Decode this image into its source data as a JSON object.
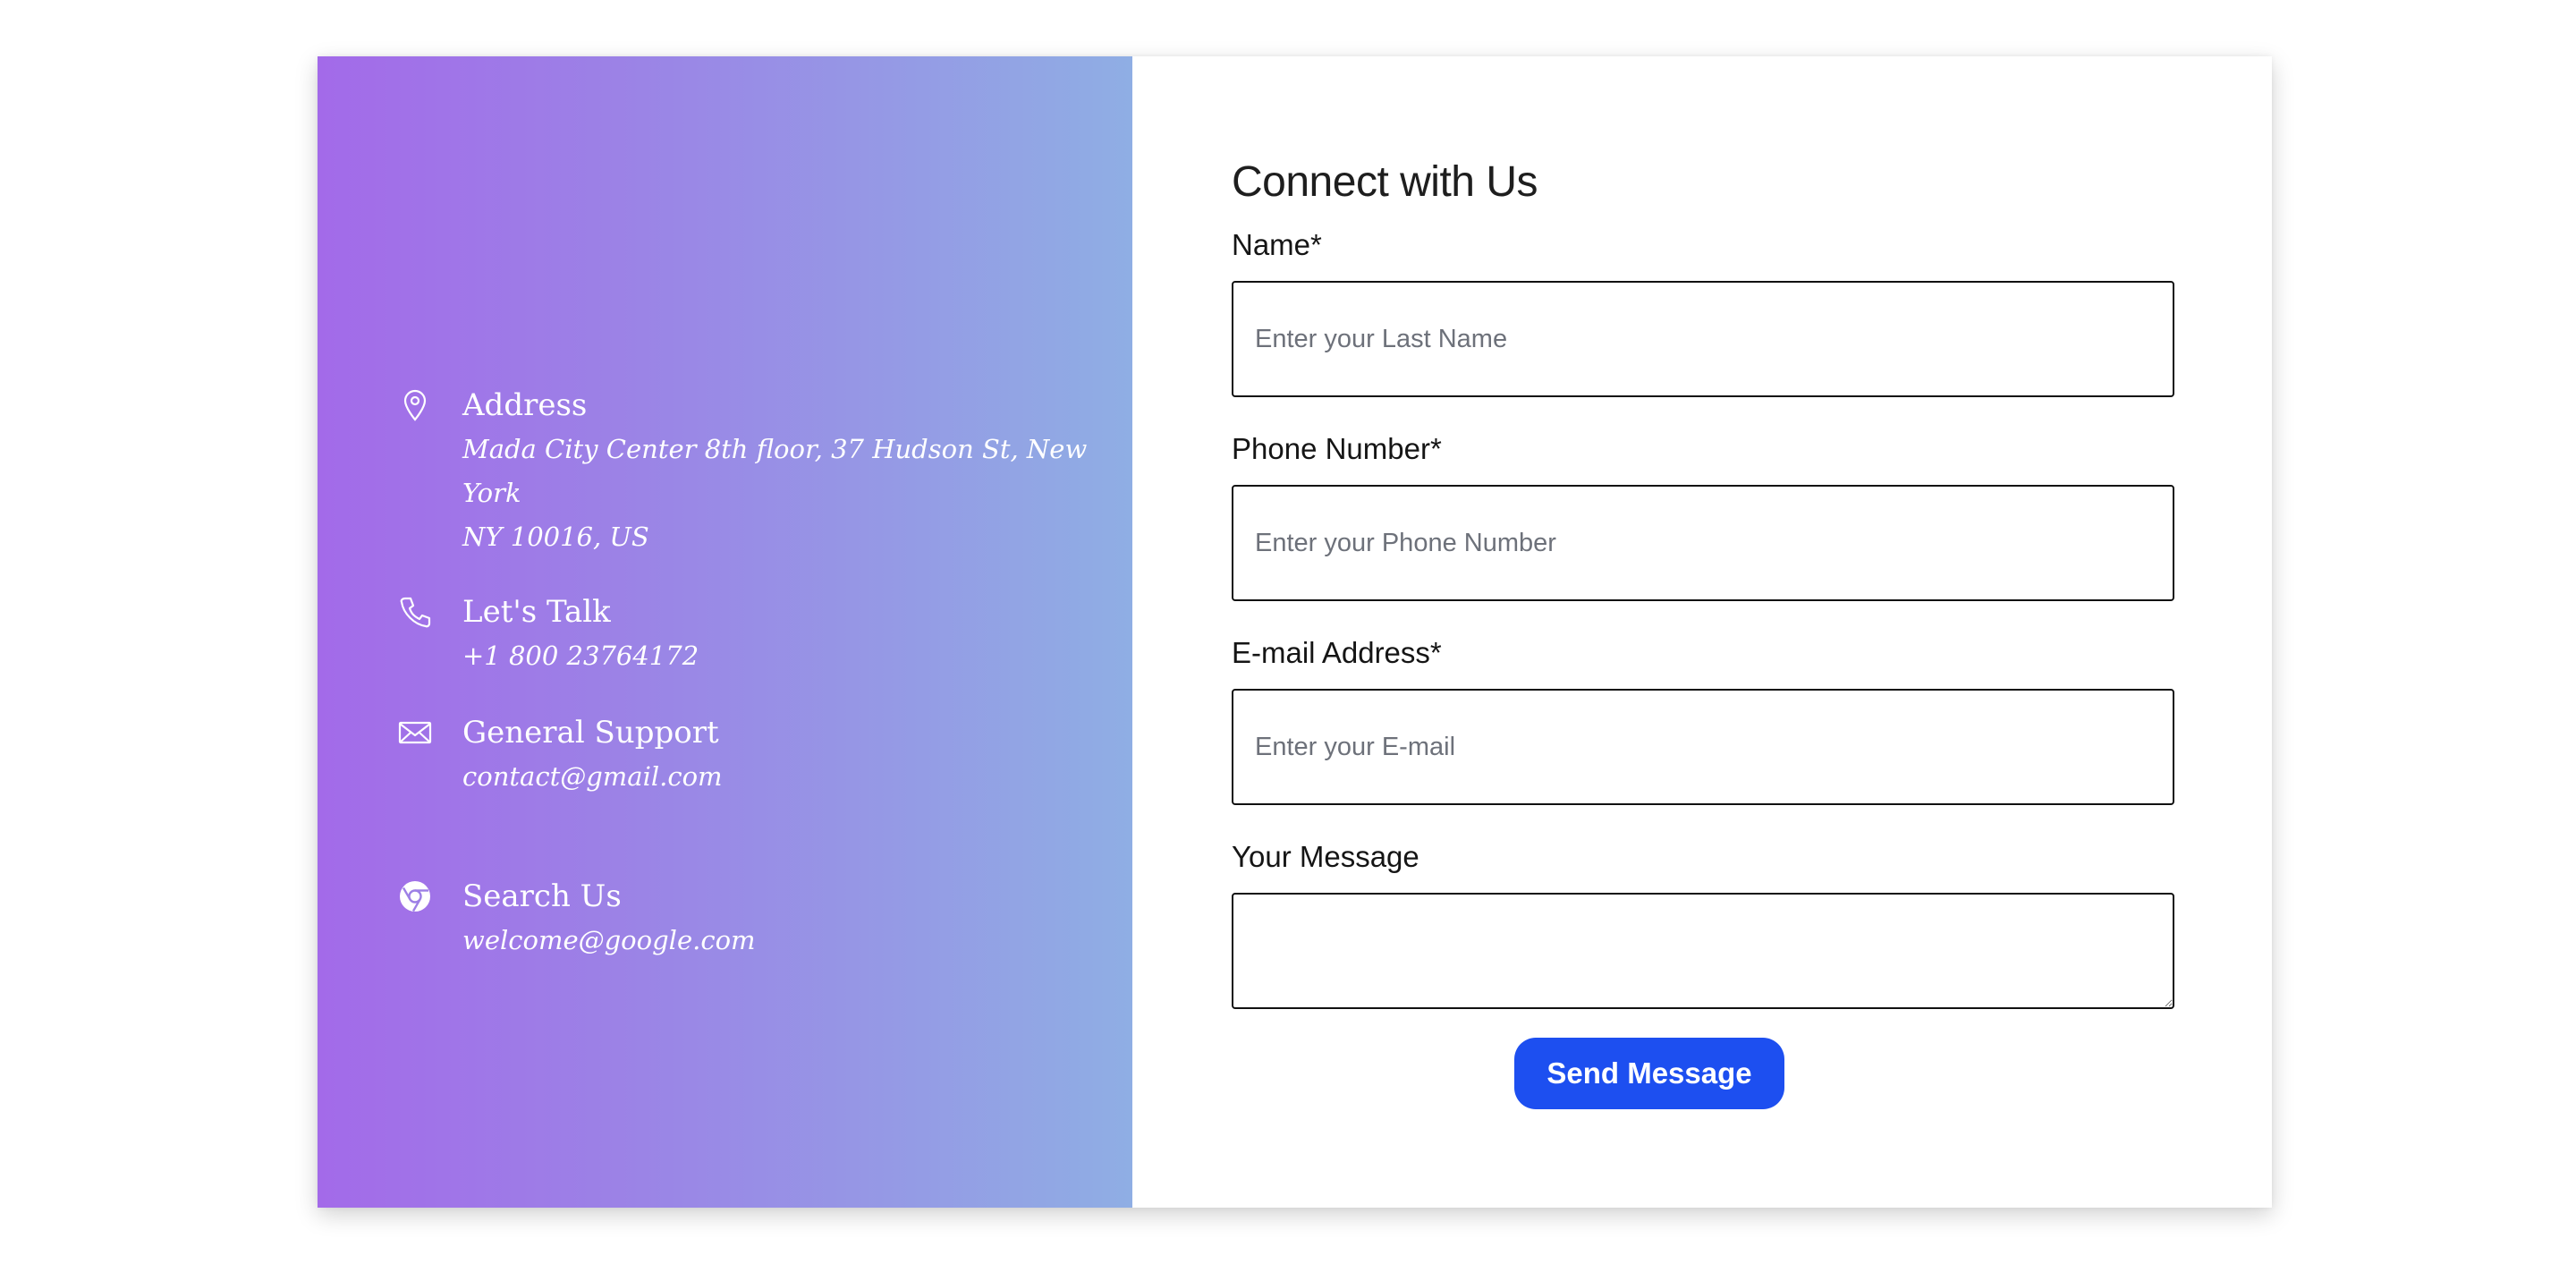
{
  "contact_info": {
    "address": {
      "icon": "map-pin-icon",
      "title": "Address",
      "detail_line1": "Mada City Center 8th floor, 37 Hudson St, New York",
      "detail_line2": "NY 10016, US"
    },
    "phone": {
      "icon": "phone-icon",
      "title": "Let's Talk",
      "detail": "+1 800 23764172"
    },
    "support": {
      "icon": "envelope-icon",
      "title": "General Support",
      "detail": "contact@gmail.com"
    },
    "search": {
      "icon": "chrome-icon",
      "title": "Search Us",
      "detail": "welcome@google.com"
    }
  },
  "form": {
    "title": "Connect with Us",
    "name": {
      "label": "Name*",
      "placeholder": "Enter your Last Name",
      "value": ""
    },
    "phone": {
      "label": "Phone Number*",
      "placeholder": "Enter your Phone Number",
      "value": ""
    },
    "email": {
      "label": "E-mail Address*",
      "placeholder": "Enter your E-mail",
      "value": ""
    },
    "message": {
      "label": "Your Message",
      "value": ""
    },
    "submit_label": "Send Message"
  },
  "colors": {
    "gradient_start": "#a36ae9",
    "gradient_end": "#8faee4",
    "button": "#1d4ff0"
  }
}
